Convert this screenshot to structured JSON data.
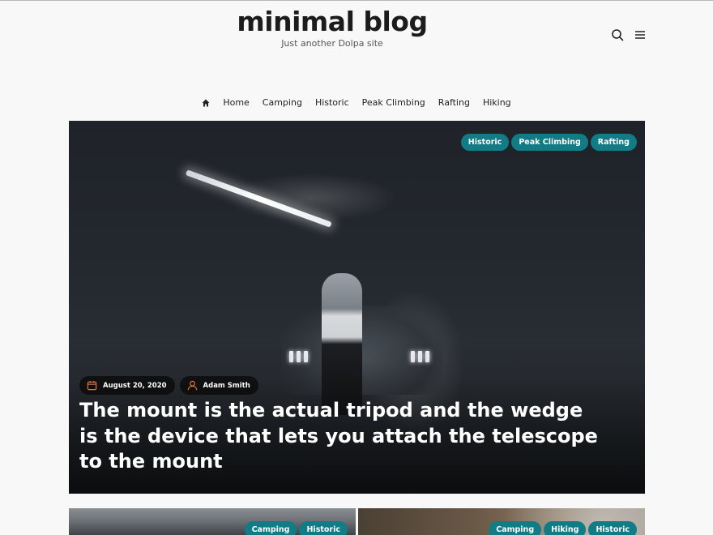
{
  "site": {
    "title": "minimal blog",
    "description": "Just another Dolpa site"
  },
  "header_icons": [
    "search-icon",
    "menu-icon"
  ],
  "nav": {
    "home_icon": "home-icon",
    "items": [
      "Home",
      "Camping",
      "Historic",
      "Peak Climbing",
      "Rafting",
      "Hiking"
    ]
  },
  "hero": {
    "tags": [
      "Historic",
      "Peak Climbing",
      "Rafting"
    ],
    "date": "August 20, 2020",
    "author": "Adam Smith",
    "date_icon": "calendar-icon",
    "author_icon": "user-icon",
    "title": "The mount is the actual tripod and the wedge is the device that lets you attach the telescope to the mount"
  },
  "cards": [
    {
      "tags": [
        "Camping",
        "Historic"
      ]
    },
    {
      "tags": [
        "Camping",
        "Hiking",
        "Historic"
      ]
    }
  ],
  "colors": {
    "tag_bg": "#117c86",
    "date_icon": "#e0703a",
    "author_icon": "#e0703a",
    "background": "#f8f8f8"
  }
}
